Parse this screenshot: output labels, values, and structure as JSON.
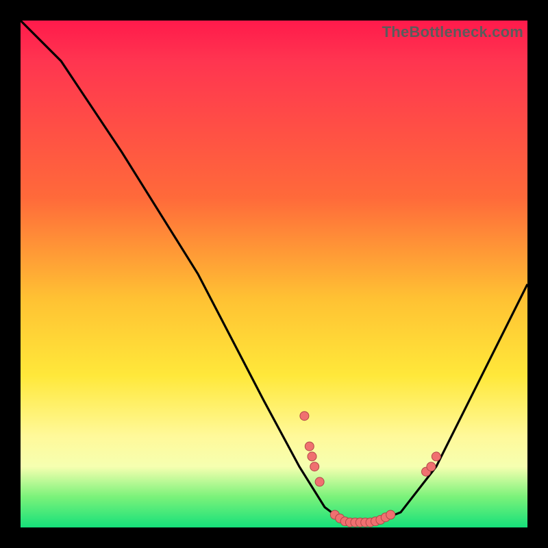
{
  "watermark": "TheBottleneck.com",
  "colors": {
    "background": "#000000",
    "curve": "#000000",
    "dot_fill": "#f07070",
    "dot_stroke": "#b04848"
  },
  "chart_data": {
    "type": "line",
    "title": "",
    "xlabel": "",
    "ylabel": "",
    "xlim": [
      0,
      100
    ],
    "ylim": [
      0,
      100
    ],
    "note": "Pixel-relative coordinates (0-100). y=0 is bottom of plot area, y=100 is top.",
    "curve": [
      {
        "x": 0,
        "y": 100
      },
      {
        "x": 8,
        "y": 92
      },
      {
        "x": 20,
        "y": 74
      },
      {
        "x": 35,
        "y": 50
      },
      {
        "x": 48,
        "y": 25
      },
      {
        "x": 55,
        "y": 12
      },
      {
        "x": 60,
        "y": 4
      },
      {
        "x": 64,
        "y": 1
      },
      {
        "x": 70,
        "y": 1
      },
      {
        "x": 75,
        "y": 3
      },
      {
        "x": 82,
        "y": 12
      },
      {
        "x": 90,
        "y": 28
      },
      {
        "x": 100,
        "y": 48
      }
    ],
    "dots": [
      {
        "x": 56,
        "y": 22
      },
      {
        "x": 57,
        "y": 16
      },
      {
        "x": 57.5,
        "y": 14
      },
      {
        "x": 58,
        "y": 12
      },
      {
        "x": 59,
        "y": 9
      },
      {
        "x": 62,
        "y": 2.5
      },
      {
        "x": 63,
        "y": 1.8
      },
      {
        "x": 64,
        "y": 1.2
      },
      {
        "x": 65,
        "y": 1
      },
      {
        "x": 66,
        "y": 1
      },
      {
        "x": 67,
        "y": 1
      },
      {
        "x": 68,
        "y": 1
      },
      {
        "x": 69,
        "y": 1
      },
      {
        "x": 70,
        "y": 1.2
      },
      {
        "x": 71,
        "y": 1.5
      },
      {
        "x": 72,
        "y": 2
      },
      {
        "x": 73,
        "y": 2.5
      },
      {
        "x": 80,
        "y": 11
      },
      {
        "x": 81,
        "y": 12
      },
      {
        "x": 82,
        "y": 14
      }
    ]
  }
}
